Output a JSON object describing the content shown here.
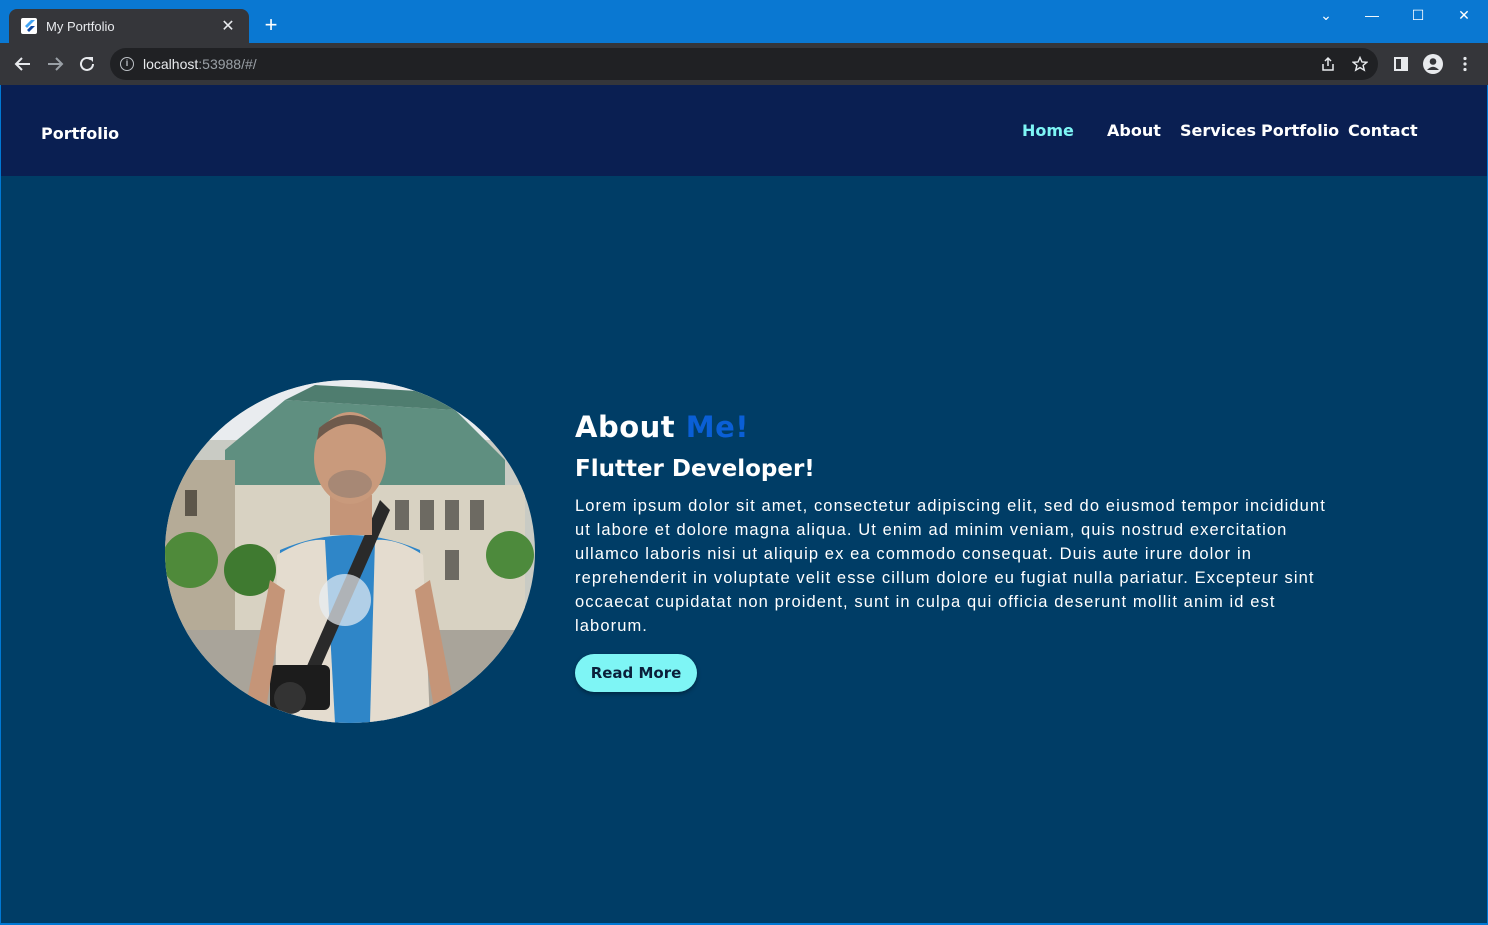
{
  "browser": {
    "tab_title": "My Portfolio",
    "tab_close": "✕",
    "new_tab": "+",
    "url_host": "localhost",
    "url_rest": ":53988/#/",
    "window_controls": {
      "dropdown": "⌄",
      "minimize": "—",
      "maximize": "☐",
      "close": "✕"
    }
  },
  "site": {
    "logo": "Portfolio",
    "nav": [
      {
        "label": "Home",
        "active": true
      },
      {
        "label": "About"
      },
      {
        "label": "Services"
      },
      {
        "label": "Portfolio"
      },
      {
        "label": "Contact"
      }
    ],
    "about": {
      "heading_main": "About",
      "heading_accent": "Me!",
      "subtitle": "Flutter Developer!",
      "bio": "Lorem ipsum dolor sit amet, consectetur adipiscing elit, sed do eiusmod tempor incididunt ut labore et dolore magna aliqua. Ut enim ad minim veniam, quis nostrud exercitation ullamco laboris nisi ut aliquip ex ea commodo consequat. Duis aute irure dolor in reprehenderit in voluptate velit esse cillum dolore eu fugiat nulla pariatur. Excepteur sint occaecat cupidatat non proident, sunt in culpa qui officia deserunt mollit anim id est laborum.",
      "button": "Read More"
    }
  },
  "colors": {
    "header_bg": "#0a1f52",
    "page_bg": "#003d66",
    "accent_cyan": "#7ef5f5",
    "accent_blue": "#0a5fd6"
  }
}
